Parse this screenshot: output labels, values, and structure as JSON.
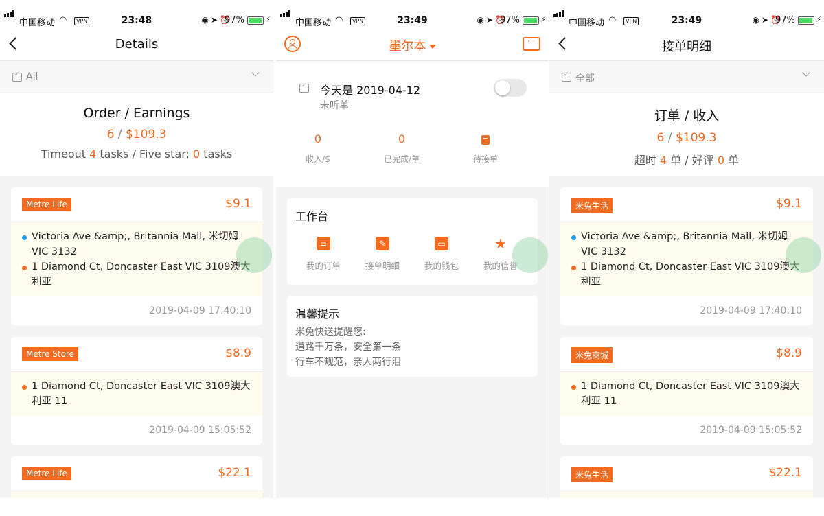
{
  "left": {
    "status": {
      "carrier": "中国移动",
      "vpn": "VPN",
      "time": "23:48",
      "battery": "97%"
    },
    "nav_title": "Details",
    "filter": "All",
    "summary": {
      "title": "Order / Earnings",
      "orders": "6",
      "amount": "$109.3",
      "timeout_prefix": "Timeout ",
      "timeout": "4",
      "mid": " tasks / Five star: ",
      "fivestar": "0",
      "suffix": " tasks"
    },
    "orders": [
      {
        "tag": "Metre Life",
        "price": "$9.1",
        "from": "Victoria Ave &amp;, Britannia Mall, 米切姆 VIC 3132",
        "to": "1 Diamond Ct, Doncaster East VIC 3109澳大利亚",
        "time": "2019-04-09 17:40:10"
      },
      {
        "tag": "Metre Store",
        "price": "$8.9",
        "to": "1 Diamond Ct, Doncaster East VIC 3109澳大利亚 11",
        "time": "2019-04-09 15:05:52"
      },
      {
        "tag": "Metre Life",
        "price": "$22.1"
      }
    ]
  },
  "middle": {
    "status": {
      "carrier": "中国移动",
      "vpn": "VPN",
      "time": "23:49",
      "battery": "97%"
    },
    "city": "墨尔本",
    "today": {
      "date": "今天是 2019-04-12",
      "state": "未听单"
    },
    "stats": [
      {
        "value": "0",
        "label": "收入/$"
      },
      {
        "value": "0",
        "label": "已完成/单"
      },
      {
        "value": "",
        "label": "待接单"
      }
    ],
    "workbench": {
      "title": "工作台",
      "items": [
        {
          "label": "我的订单",
          "icon": "orders-icon"
        },
        {
          "label": "接单明细",
          "icon": "edit-list-icon"
        },
        {
          "label": "我的钱包",
          "icon": "wallet-icon"
        },
        {
          "label": "我的信誉",
          "icon": "star-icon"
        }
      ]
    },
    "tips": {
      "title": "温馨提示",
      "lines": [
        "米兔快送提醒您:",
        "道路千万条，安全第一条",
        "行车不规范，亲人两行泪"
      ]
    }
  },
  "right": {
    "status": {
      "carrier": "中国移动",
      "vpn": "VPN",
      "time": "23:49",
      "battery": "97%"
    },
    "nav_title": "接单明细",
    "filter": "全部",
    "summary": {
      "title": "订单 / 收入",
      "orders": "6",
      "amount": "$109.3",
      "timeout_prefix": "超时 ",
      "timeout": "4",
      "mid": " 单 / 好评 ",
      "fivestar": "0",
      "suffix": " 单"
    },
    "orders": [
      {
        "tag": "米兔生活",
        "price": "$9.1",
        "from": "Victoria Ave &amp;, Britannia Mall, 米切姆 VIC 3132",
        "to": "1 Diamond Ct, Doncaster East VIC 3109澳大利亚",
        "time": "2019-04-09 17:40:10"
      },
      {
        "tag": "米兔商城",
        "price": "$8.9",
        "to": "1 Diamond Ct, Doncaster East VIC 3109澳大利亚 11",
        "time": "2019-04-09 15:05:52"
      },
      {
        "tag": "米兔生活",
        "price": "$22.1"
      }
    ]
  },
  "colors": {
    "accent": "#f26b21",
    "address_bg": "#fffbee",
    "pickup_dot": "#1e9cf0"
  }
}
